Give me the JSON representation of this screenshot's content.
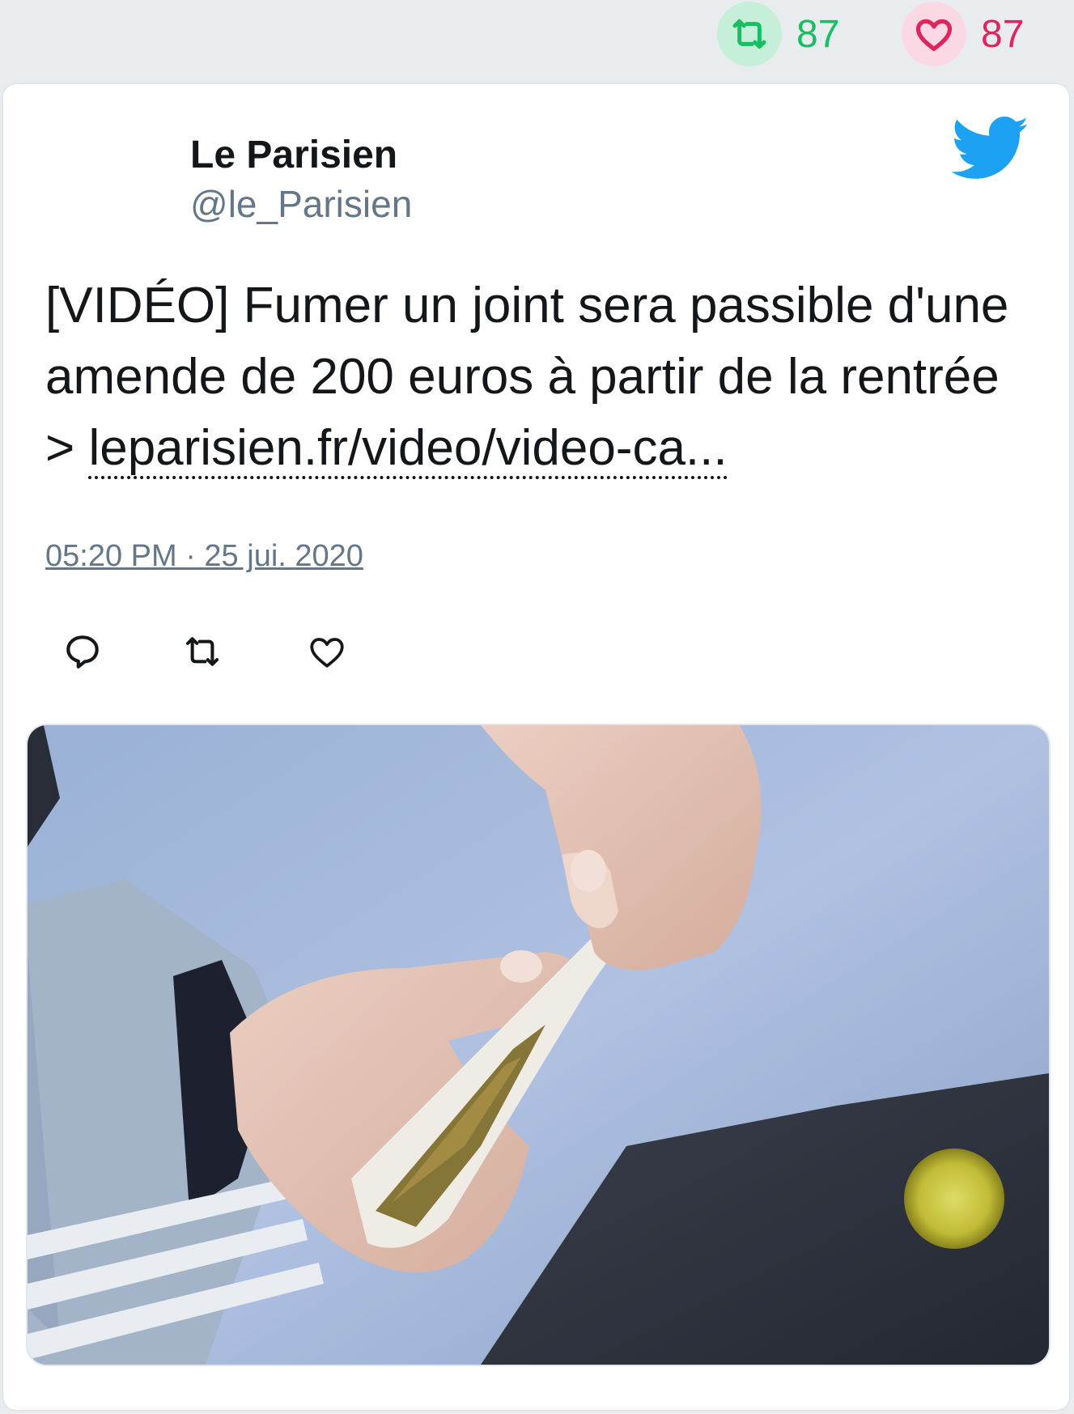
{
  "stats": {
    "retweets": "87",
    "likes": "87"
  },
  "tweet": {
    "author_name": "Le Parisien",
    "author_handle": "@le_Parisien",
    "text": "[VIDÉO] Fumer un joint sera passible d'une amende de 200 euros à partir de la rentrée > ",
    "link_text": "leparisien.fr/video/video-ca...",
    "timestamp": "05:20 PM · 25 jui. 2020"
  },
  "icons": {
    "retweet": "retweet-icon",
    "like": "heart-icon",
    "reply": "reply-icon",
    "brand": "twitter-bird-icon"
  },
  "colors": {
    "retweet_accent": "#17bf63",
    "like_accent": "#e0245e",
    "twitter_blue": "#1da1f2",
    "muted_text": "#657786"
  }
}
